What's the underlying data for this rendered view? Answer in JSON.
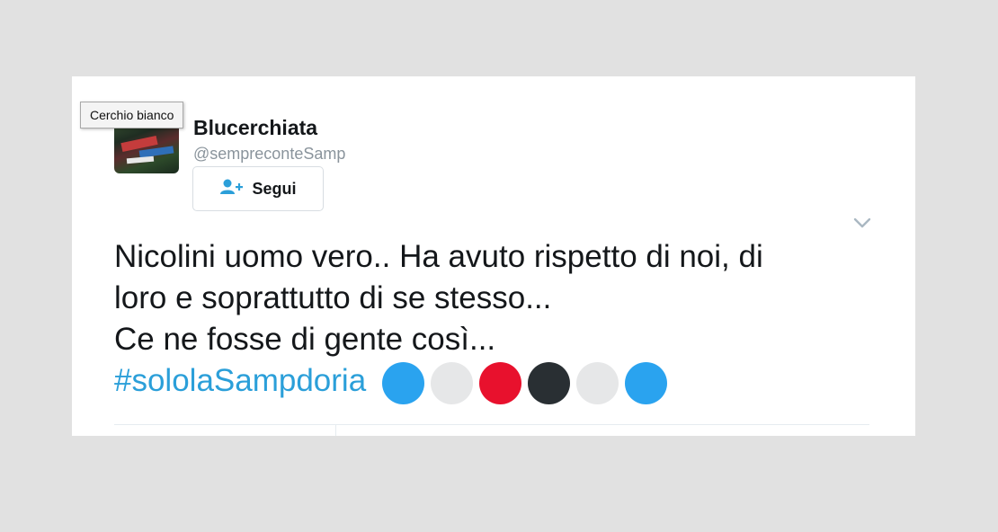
{
  "tweet": {
    "display_name": "Blucerchiata",
    "handle": "@sempreconteSamp",
    "follow_label": "Segui",
    "text_lines": [
      "Nicolini uomo vero.. Ha avuto rispetto di noi, di",
      "loro e soprattutto di se stesso...",
      "Ce ne fosse di gente così..."
    ],
    "hashtag": "#sololaSampdoria",
    "emoji_circles": [
      {
        "name": "blue-circle",
        "color": "#2aa3ef"
      },
      {
        "name": "white-circle",
        "color": "#e6e7e8"
      },
      {
        "name": "red-circle",
        "color": "#e8112d"
      },
      {
        "name": "black-circle",
        "color": "#292f33"
      },
      {
        "name": "white-circle",
        "color": "#e6e7e8"
      },
      {
        "name": "blue-circle",
        "color": "#2aa3ef"
      }
    ]
  },
  "tooltip": {
    "text": "Cerchio bianco"
  },
  "colors": {
    "link": "#2b9fd9",
    "page_background": "#e1e1e1"
  }
}
